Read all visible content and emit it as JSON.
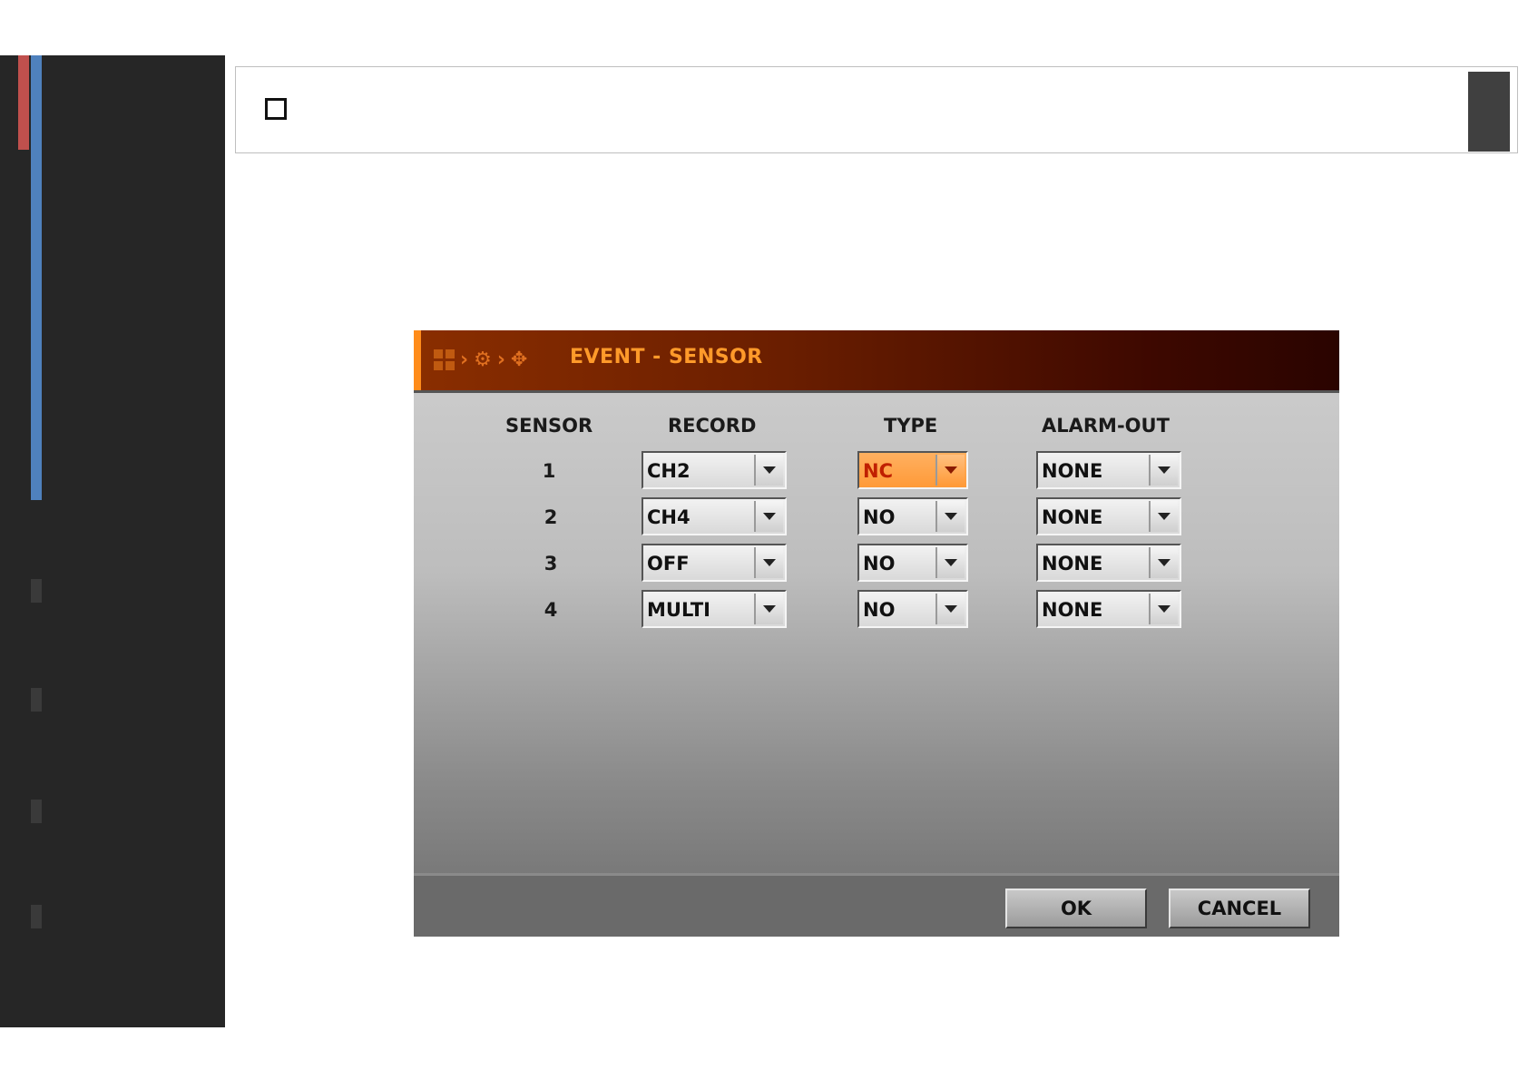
{
  "dialog": {
    "title": "EVENT - SENSOR",
    "columns": {
      "sensor": "SENSOR",
      "record": "RECORD",
      "type": "TYPE",
      "alarm_out": "ALARM-OUT"
    },
    "rows": [
      {
        "sensor": "1",
        "record": "CH2",
        "type": "NC",
        "alarm_out": "NONE"
      },
      {
        "sensor": "2",
        "record": "CH4",
        "type": "NO",
        "alarm_out": "NONE"
      },
      {
        "sensor": "3",
        "record": "OFF",
        "type": "NO",
        "alarm_out": "NONE"
      },
      {
        "sensor": "4",
        "record": "MULTI",
        "type": "NO",
        "alarm_out": "NONE"
      }
    ],
    "buttons": {
      "ok": "OK",
      "cancel": "CANCEL"
    }
  },
  "icons": {
    "breadcrumb": [
      "grid-icon",
      "chevron-right-icon",
      "gear-icon",
      "chevron-right-icon",
      "move-icon"
    ],
    "header": "checkbox-icon"
  },
  "colors": {
    "accent": "#ff9a2a",
    "titlebar": "#6a1e00",
    "sidebar": "#262626",
    "sidebar_red": "#c0504d",
    "sidebar_blue": "#4f81bd"
  }
}
